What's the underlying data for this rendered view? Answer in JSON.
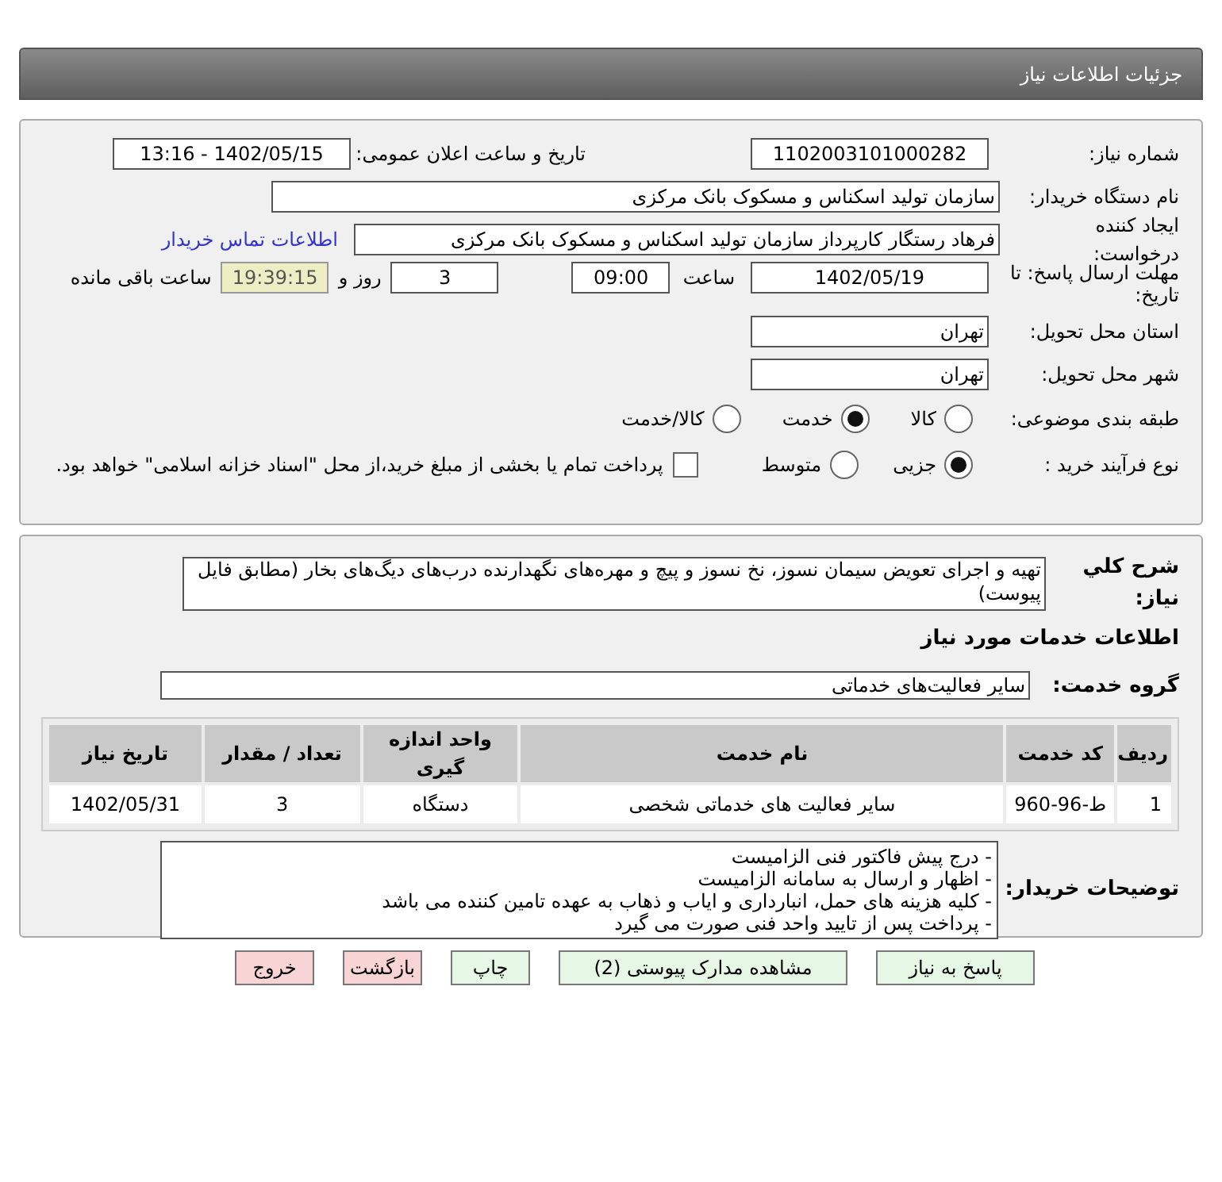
{
  "header": {
    "title": "جزئیات اطلاعات نیاز"
  },
  "details": {
    "need_number_label": "شماره نیاز:",
    "need_number": "1102003101000282",
    "announce_label": "تاریخ و ساعت اعلان عمومی:",
    "announce": "1402/05/15 - 13:16",
    "buyer_label": "نام دستگاه خریدار:",
    "buyer": "سازمان تولید اسکناس و مسکوک بانک مرکزی",
    "creator_label": "ایجاد کننده درخواست:",
    "creator": "فرهاد رستگار کارپرداز سازمان تولید اسکناس و مسکوک بانک مرکزی",
    "contact_link": "اطلاعات تماس خریدار",
    "deadline_label": "مهلت ارسال پاسخ: تا تاریخ:",
    "deadline_date": "1402/05/19",
    "time_label": "ساعت",
    "deadline_time": "09:00",
    "days": "3",
    "days_label": "روز و",
    "remaining": "19:39:15",
    "remaining_label": "ساعت باقی مانده",
    "province_label": "استان محل تحویل:",
    "province": "تهران",
    "city_label": "شهر محل تحویل:",
    "city": "تهران",
    "category_label": "طبقه بندی موضوعی:",
    "categories": [
      {
        "label": "کالا",
        "selected": false
      },
      {
        "label": "خدمت",
        "selected": true
      },
      {
        "label": "کالا/خدمت",
        "selected": false
      }
    ],
    "process_label": "نوع فرآیند خرید :",
    "processes": [
      {
        "label": "جزیی",
        "selected": true
      },
      {
        "label": "متوسط",
        "selected": false
      }
    ],
    "treasury": {
      "checked": false,
      "label": "پرداخت تمام یا بخشی از مبلغ خرید،از محل \"اسناد خزانه اسلامی\" خواهد بود."
    }
  },
  "services": {
    "summary_label": "شرح کلي نیاز:",
    "summary": "تهیه و اجرای تعویض سیمان نسوز، نخ نسوز و پیچ و مهره‌های نگهدارنده درب‌های دیگ‌های بخار (مطابق فایل پیوست)",
    "heading": "اطلاعات خدمات مورد نیاز",
    "group_label": "گروه خدمت:",
    "group": "سایر فعالیت‌های خدماتی",
    "table": {
      "columns": [
        "ردیف",
        "کد خدمت",
        "نام خدمت",
        "واحد اندازه گیری",
        "تعداد / مقدار",
        "تاریخ نیاز"
      ],
      "rows": [
        [
          "1",
          "ط-96-960",
          "سایر فعالیت های خدماتی شخصی",
          "دستگاه",
          "3",
          "1402/05/31"
        ]
      ]
    },
    "notes_label": "توضیحات خریدار:",
    "notes": [
      "- درج پیش فاکتور فنی الزامیست",
      "- اظهار و ارسال به سامانه الزامیست",
      "- کلیه هزینه های حمل، انبارداری و ایاب و ذهاب به عهده تامین کننده می باشد",
      "- پرداخت پس از تایید واحد فنی صورت می گیرد"
    ]
  },
  "buttons": [
    {
      "label": "پاسخ به نیاز",
      "kind": "normal"
    },
    {
      "label": "مشاهده مدارک پیوستی (2)",
      "kind": "normal"
    },
    {
      "label": "چاپ",
      "kind": "normal"
    },
    {
      "label": "بازگشت",
      "kind": "danger"
    },
    {
      "label": "خروج",
      "kind": "danger"
    }
  ]
}
